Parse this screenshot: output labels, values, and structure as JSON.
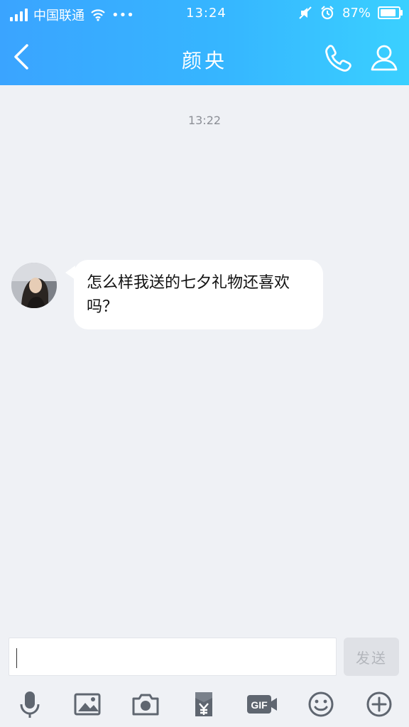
{
  "status_bar": {
    "carrier": "中国联通",
    "more": "•••",
    "time": "13:24",
    "battery": "87%"
  },
  "header": {
    "title": "颜央"
  },
  "chat": {
    "timestamp": "13:22",
    "messages": [
      {
        "sender": "contact",
        "text": "怎么样我送的七夕礼物还喜欢吗？"
      }
    ]
  },
  "input": {
    "value": "",
    "send_label": "发送"
  },
  "toolbar": {
    "icons": [
      "mic-icon",
      "image-icon",
      "camera-icon",
      "red-packet-icon",
      "gif-icon",
      "emoji-icon",
      "plus-icon"
    ]
  },
  "colors": {
    "header_gradient_start": "#3aa4ff",
    "header_gradient_end": "#3ad0ff",
    "background": "#eff1f5"
  }
}
